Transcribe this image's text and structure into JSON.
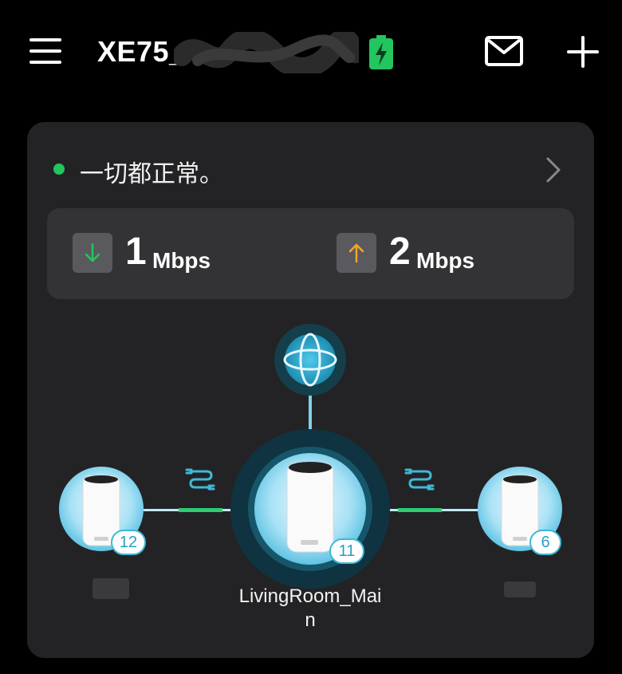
{
  "header": {
    "title": "XE75_",
    "icons": [
      "menu-icon",
      "battery-charging-icon",
      "mail-icon",
      "add-icon"
    ],
    "battery_color": "#22c55e"
  },
  "status": {
    "text": "一切都正常。",
    "dot_color": "#22c55e"
  },
  "speed": {
    "download": {
      "value": "1",
      "unit": "Mbps",
      "arrow_color": "#22c55e"
    },
    "upload": {
      "value": "2",
      "unit": "Mbps",
      "arrow_color": "#f5a623"
    }
  },
  "topology": {
    "internet_icon": "globe-icon",
    "main": {
      "label": "LivingRoom_Mai\nn",
      "clients": "11"
    },
    "left": {
      "label": "",
      "clients": "12"
    },
    "right": {
      "label": "",
      "clients": "6"
    },
    "link_icon": "ethernet-link-icon",
    "accent": "#3fb8d6",
    "link_good_color": "#2ecc71"
  }
}
